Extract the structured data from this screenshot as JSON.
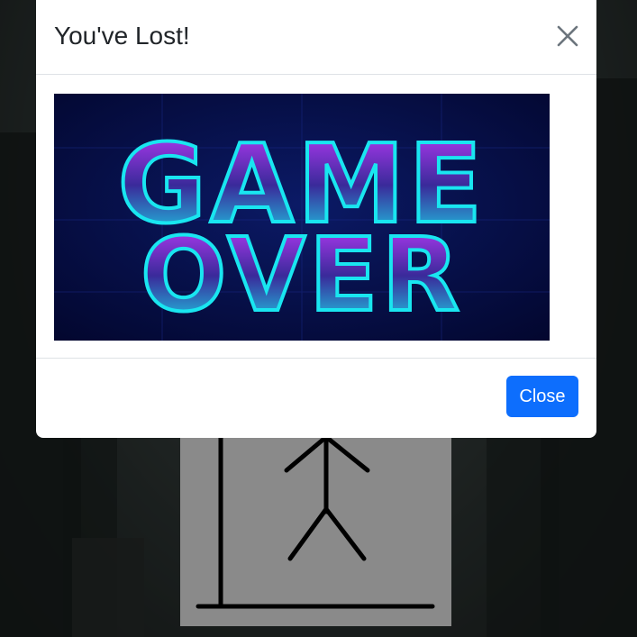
{
  "modal": {
    "title": "You've Lost!",
    "image_text": "GAME OVER",
    "close_button_label": "Close",
    "close_icon": "close-icon"
  },
  "board": {
    "figure": "hangman-figure"
  },
  "colors": {
    "primary_button": "#0d6efd",
    "board_bg": "#8a8a8a",
    "image_bg": "#05093a",
    "neon_cyan": "#19e6f0",
    "neon_magenta": "#c13bff"
  }
}
